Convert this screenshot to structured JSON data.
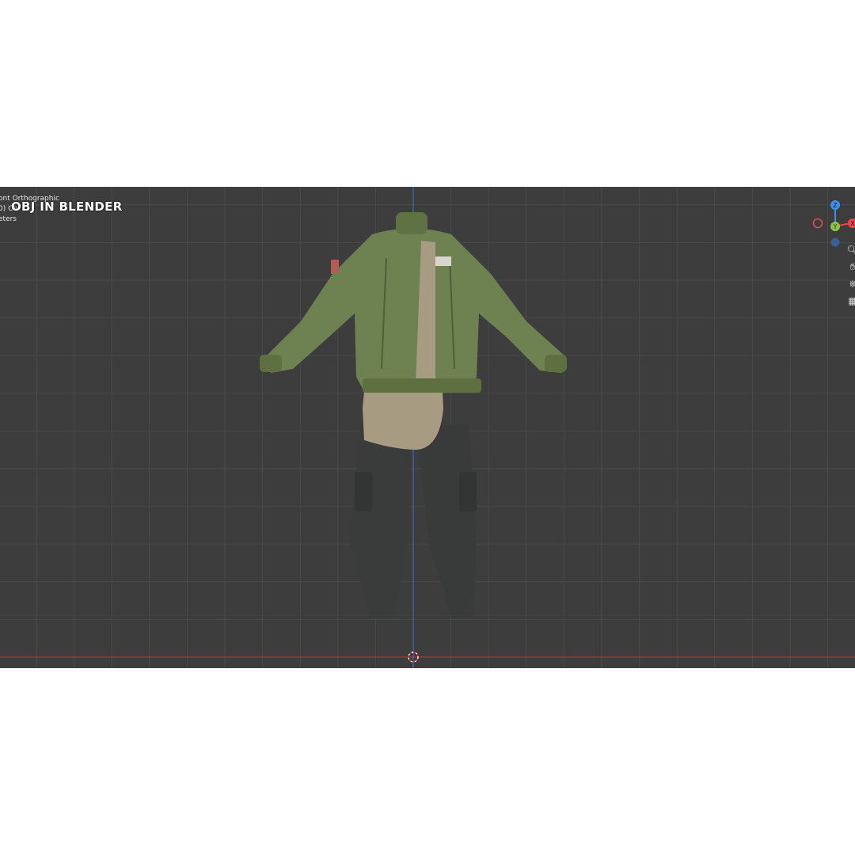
{
  "viewport": {
    "view_lines": [
      "ont Orthographic",
      "0) Co",
      "eters"
    ],
    "caption": "OBJ IN BLENDER"
  },
  "gizmo": {
    "z_label": "Z",
    "y_label": "Y",
    "x_label": "X",
    "colors": {
      "x": "#e8474f",
      "y": "#8bc34a",
      "z": "#3f8ee8"
    }
  },
  "navigation": {
    "zoom_icon": "magnify-icon",
    "pan_icon": "hand-icon",
    "camera_icon": "camera-icon",
    "grid_icon": "grid-icon"
  },
  "colors": {
    "background": "#3d3d3d",
    "grid": "#4a4a4a",
    "x_axis": "#a63a3a",
    "y_axis": "#3a6fb0",
    "jacket": "#6e8150",
    "shirt": "#a79b82",
    "pants": "#3a3b3b"
  }
}
